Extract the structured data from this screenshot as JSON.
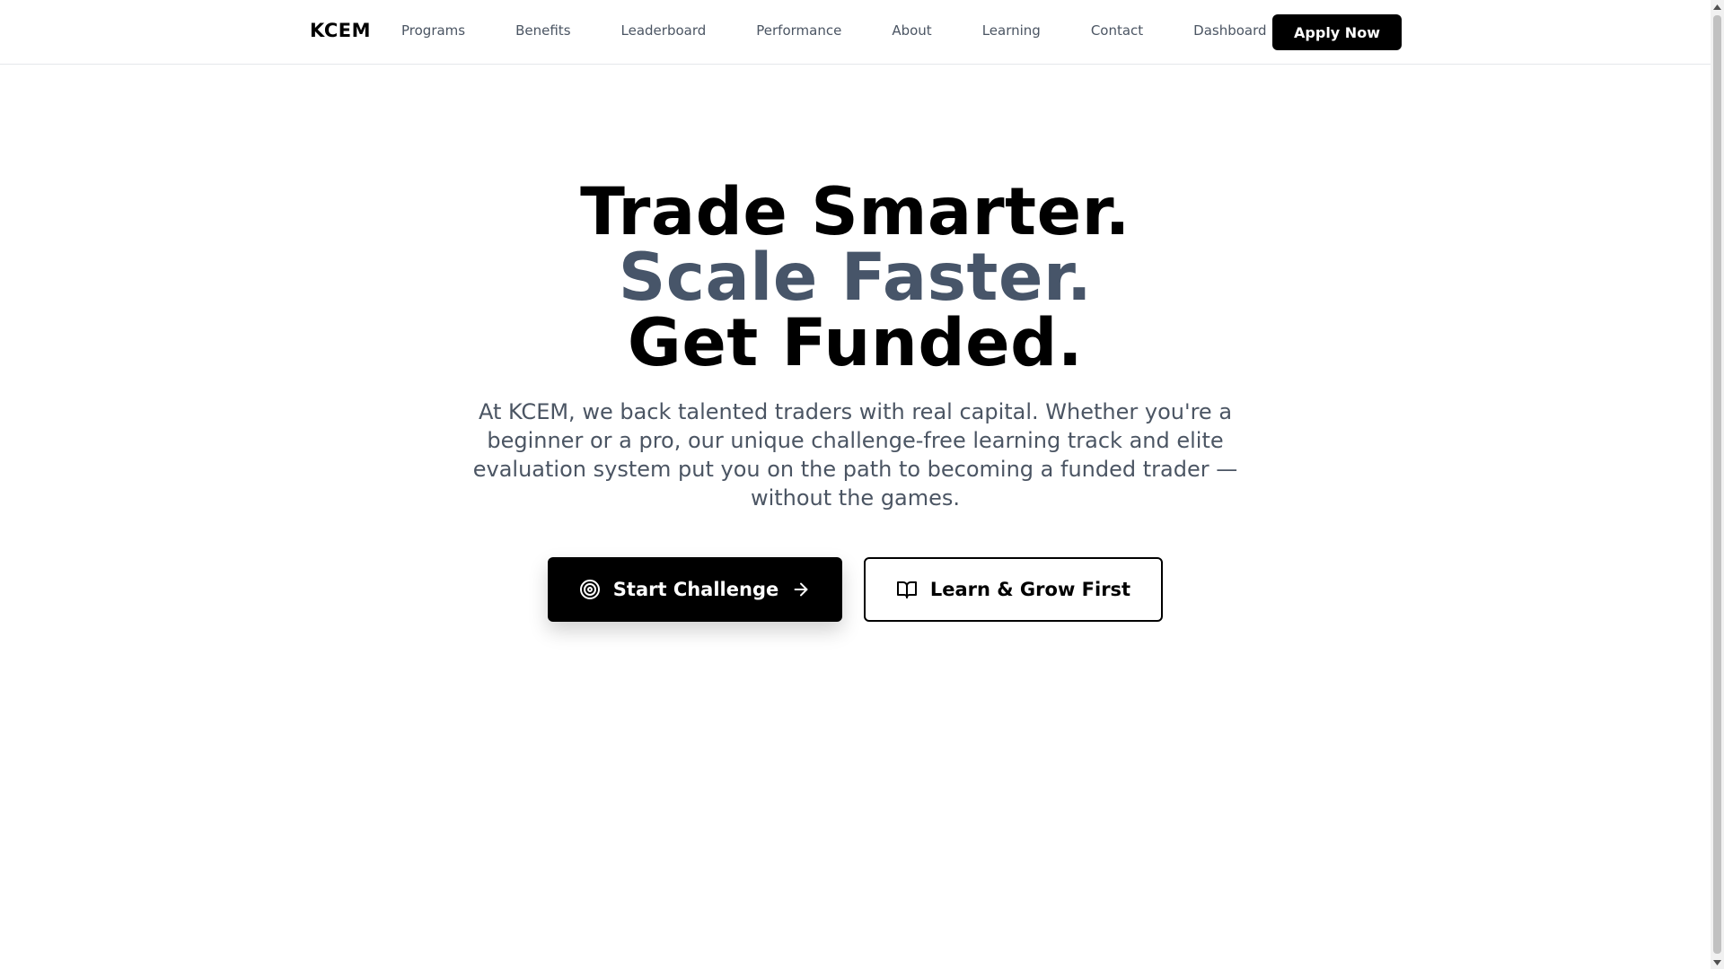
{
  "nav": {
    "brand": "KCEM",
    "links": [
      "Programs",
      "Benefits",
      "Leaderboard",
      "Performance",
      "About",
      "Learning",
      "Contact",
      "Dashboard"
    ],
    "apply_label": "Apply Now"
  },
  "hero": {
    "line1": "Trade Smarter.",
    "line2": "Scale Faster.",
    "line3": "Get Funded.",
    "description": "At KCEM, we back talented traders with real capital. Whether you're a beginner or a pro, our unique challenge-free learning track and elite evaluation system put you on the path to becoming a funded trader — without the games.",
    "primary_cta": {
      "label": "Start Challenge",
      "icon": "target-icon",
      "trailing_icon": "arrow-right-icon"
    },
    "secondary_cta": {
      "label": "Learn & Grow First",
      "icon": "book-open-icon"
    }
  },
  "colors": {
    "accent_text": "#475569",
    "body_text": "#4b5563",
    "primary": "#000000",
    "background": "#ffffff"
  }
}
